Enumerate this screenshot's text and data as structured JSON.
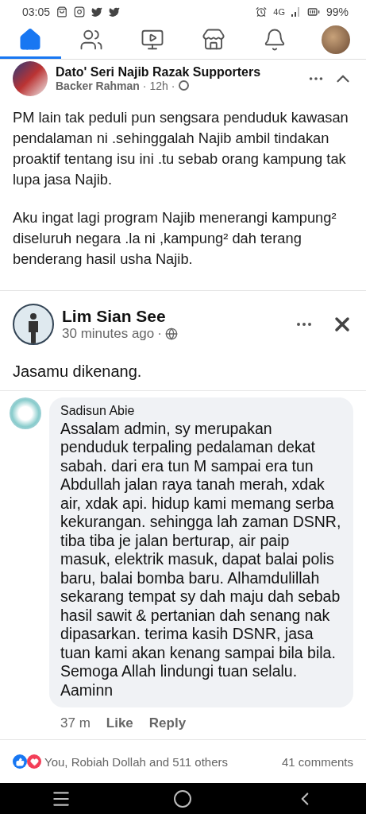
{
  "status_bar": {
    "time": "03:05",
    "network": "4G",
    "battery": "99%"
  },
  "nav_tabs": [
    {
      "kind": "home",
      "selected": true
    },
    {
      "kind": "friends",
      "selected": false
    },
    {
      "kind": "video",
      "selected": false
    },
    {
      "kind": "marketplace",
      "selected": false
    },
    {
      "kind": "notifications",
      "selected": false
    },
    {
      "kind": "profile",
      "selected": false
    }
  ],
  "post": {
    "group": "Dato' Seri Najib Razak Supporters",
    "author": "Backer Rahman",
    "separator": "·",
    "time": "12h",
    "paragraphs": [
      "PM lain tak peduli pun sengsara penduduk kawasan pendalaman ni .sehinggalah Najib ambil tindakan proaktif tentang isu ini .tu sebab orang kampung tak lupa jasa Najib.",
      "Aku ingat lagi program Najib menerangi kampung² diseluruh negara .la ni ,kampung² dah terang benderang hasil usha Najib."
    ]
  },
  "shared_post": {
    "author": "Lim Sian See",
    "time": "30 minutes ago",
    "separator": "·",
    "text": "Jasamu dikenang."
  },
  "comment": {
    "author": "Sadisun Abie",
    "text": "Assalam admin, sy merupakan penduduk terpaling pedalaman dekat sabah. dari era tun M sampai era tun Abdullah jalan raya tanah merah, xdak air, xdak api. hidup kami memang serba kekurangan. sehingga lah zaman DSNR, tiba tiba je jalan berturap, air paip masuk, elektrik masuk, dapat balai polis baru, balai bomba baru. Alhamdulillah sekarang tempat sy dah maju dah sebab hasil sawit & pertanian dah senang nak dipasarkan. terima kasih DSNR, jasa tuan kami akan kenang sampai bila bila. Semoga Allah lindungi tuan selalu. Aaminn",
    "time": "37 m",
    "actions": [
      "Like",
      "Reply"
    ]
  },
  "reactions": {
    "summary": "You, Robiah Dollah and 511 others",
    "comments": "41 comments"
  }
}
